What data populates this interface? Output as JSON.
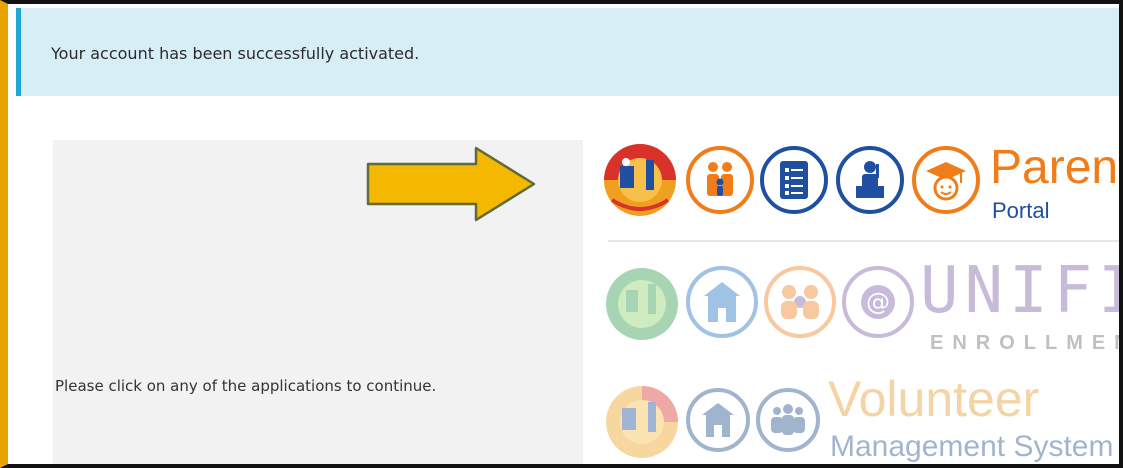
{
  "alert": {
    "message": "Your account has been successfully activated.",
    "accent_color": "#1fa7d6",
    "background_color": "#d7eef7"
  },
  "instruction": {
    "text": "Please click on any of the applications to continue."
  },
  "arrow": {
    "color": "#f5b800",
    "icon": "arrow-right-icon"
  },
  "apps": [
    {
      "id": "parent-portal",
      "title_main": "Parent",
      "title_sub": "Portal",
      "icons": [
        "lausd-seal-icon",
        "family-icon",
        "report-card-icon",
        "teacher-icon",
        "graduate-icon"
      ],
      "color": "#f07d1a",
      "accent_color": "#1e4fa0"
    },
    {
      "id": "unified-enrollment",
      "title_main": "UNIFIED",
      "title_sub": "ENROLLMENT",
      "icons": [
        "lausd-seal-icon",
        "schoolhouse-icon",
        "family-group-icon",
        "at-sign-icon"
      ],
      "color": "#7b5ea7"
    },
    {
      "id": "volunteer-management",
      "title_main": "Volunteer",
      "title_sub": "Management System",
      "icons": [
        "lausd-seal-icon",
        "schoolhouse-icon",
        "people-group-icon"
      ],
      "color": "#1f4e8c"
    }
  ]
}
